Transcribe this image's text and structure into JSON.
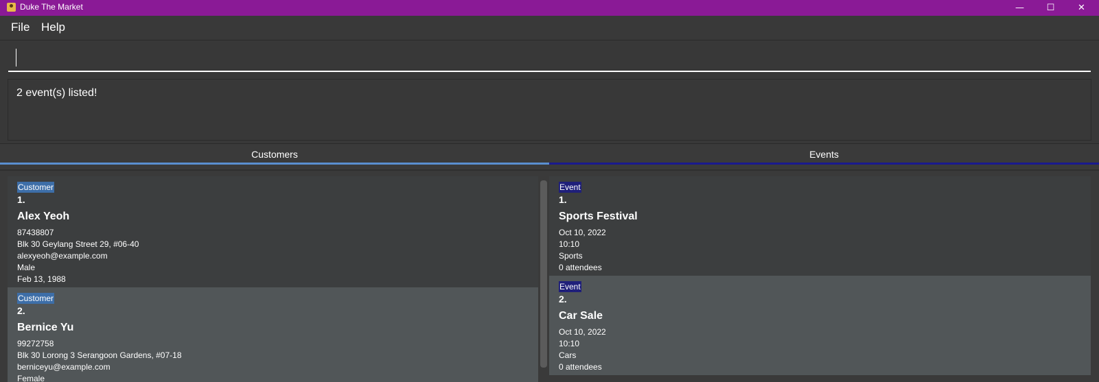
{
  "window": {
    "title": "Duke The Market",
    "minimize_icon": "minimize-icon",
    "maximize_icon": "maximize-icon",
    "close_icon": "close-icon"
  },
  "menu": {
    "file": "File",
    "help": "Help"
  },
  "command": {
    "value": ""
  },
  "result": {
    "text": "2 event(s) listed!"
  },
  "tabs": {
    "customers": "Customers",
    "events": "Events",
    "customers_accent": "#5a8fd0",
    "events_accent": "#1a1a8f"
  },
  "customers": [
    {
      "badge": "Customer",
      "index": "1.",
      "name": "Alex Yeoh",
      "phone": "87438807",
      "address": "Blk 30 Geylang Street 29, #06-40",
      "email": "alexyeoh@example.com",
      "gender": "Male",
      "dob": "Feb 13, 1988"
    },
    {
      "badge": "Customer",
      "index": "2.",
      "name": "Bernice Yu",
      "phone": "99272758",
      "address": "Blk 30 Lorong 3 Serangoon Gardens, #07-18",
      "email": "berniceyu@example.com",
      "gender": "Female"
    }
  ],
  "events": [
    {
      "badge": "Event",
      "index": "1.",
      "name": "Sports Festival",
      "date": "Oct 10, 2022",
      "time": "10:10",
      "venue": "Sports",
      "attendees": "0 attendees"
    },
    {
      "badge": "Event",
      "index": "2.",
      "name": "Car Sale",
      "date": "Oct 10, 2022",
      "time": "10:10",
      "venue": "Cars",
      "attendees": "0 attendees"
    }
  ],
  "colors": {
    "titlebar": "#8a1a96",
    "customer_badge": "#3d6ea8",
    "event_badge": "#1f1f7a",
    "card_dark": "#3c3e3f",
    "card_light": "#515658"
  }
}
